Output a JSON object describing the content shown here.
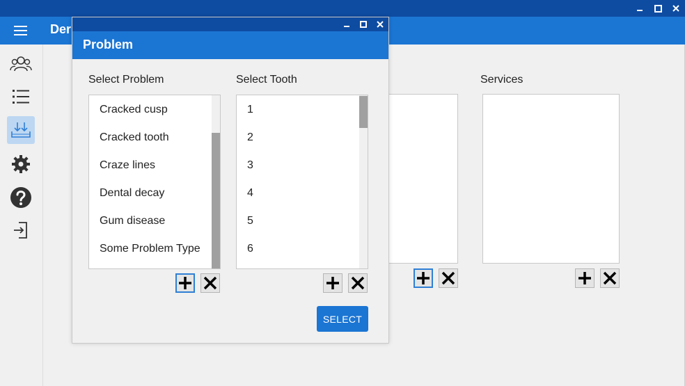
{
  "window": {
    "title_controls": {
      "minimize": "—",
      "maximize": "☐",
      "close": "✕"
    },
    "app_title": "Der"
  },
  "sidebar": {
    "items": [
      {
        "icon": "users-icon",
        "active": false
      },
      {
        "icon": "list-icon",
        "active": false
      },
      {
        "icon": "download-tray-icon",
        "active": true
      },
      {
        "icon": "gear-icon",
        "active": false
      },
      {
        "icon": "help-icon",
        "active": false
      },
      {
        "icon": "logout-icon",
        "active": false
      }
    ]
  },
  "main": {
    "services_label": "Services"
  },
  "dialog": {
    "title": "Problem",
    "controls": {
      "minimize": "—",
      "maximize": "☐",
      "close": "✕"
    },
    "problem_label": "Select Problem",
    "tooth_label": "Select Tooth",
    "problems": [
      "Cracked cusp",
      "Cracked tooth",
      "Craze lines",
      "Dental decay",
      "Gum disease",
      "Some Problem Type"
    ],
    "teeth": [
      "1",
      "2",
      "3",
      "4",
      "5",
      "6"
    ],
    "select_label": "SELECT"
  },
  "colors": {
    "titlebar": "#0e4ca2",
    "appbar": "#1b75d3",
    "accent": "#2f7fd5",
    "active_sidebar": "#bdd7f2"
  }
}
